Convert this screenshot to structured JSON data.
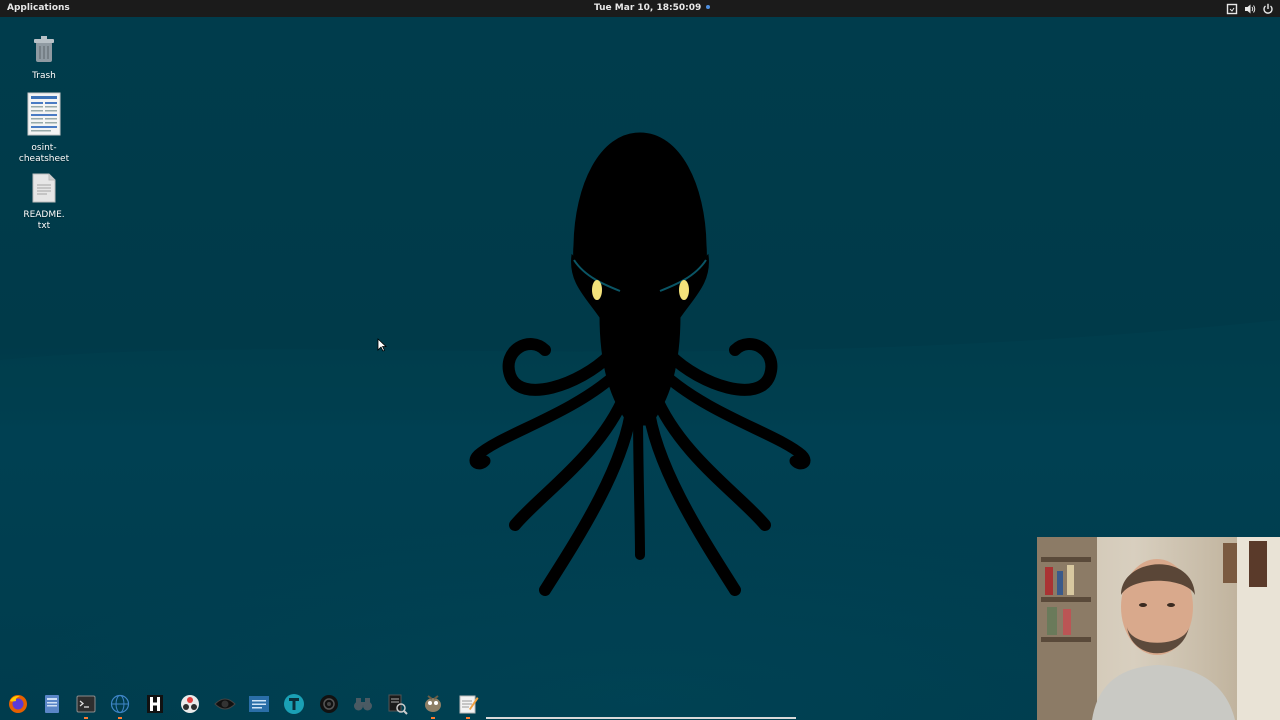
{
  "topbar": {
    "applications_label": "Applications",
    "clock": "Tue Mar 10, 18:50:09",
    "tray_icons": [
      "screen-icon",
      "volume-icon",
      "power-icon"
    ]
  },
  "desktop_icons": [
    {
      "label": "Trash",
      "icon": "trash-icon"
    },
    {
      "label": "osint-\ncheatsheet",
      "icon": "document-icon"
    },
    {
      "label": "README.\ntxt",
      "icon": "text-file-icon"
    }
  ],
  "wallpaper": {
    "subject": "octopus",
    "background_color": "#003b4a",
    "eye_color": "#f3e27a"
  },
  "dock": {
    "items": [
      {
        "name": "firefox-icon",
        "running": false
      },
      {
        "name": "files-icon",
        "running": false
      },
      {
        "name": "terminal-icon",
        "running": true
      },
      {
        "name": "network-globe-icon",
        "running": true
      },
      {
        "name": "hashcat-icon",
        "running": false
      },
      {
        "name": "maltego-icon",
        "running": false
      },
      {
        "name": "eye-icon",
        "running": false
      },
      {
        "name": "haveibeenpwned-icon",
        "running": false
      },
      {
        "name": "tor-browser-icon",
        "running": false
      },
      {
        "name": "camera-lens-icon",
        "running": false
      },
      {
        "name": "binoculars-icon",
        "running": false
      },
      {
        "name": "document-search-icon",
        "running": false
      },
      {
        "name": "gimp-icon",
        "running": true
      },
      {
        "name": "text-editor-icon",
        "running": true
      }
    ]
  },
  "webcam": {
    "visible": true
  }
}
